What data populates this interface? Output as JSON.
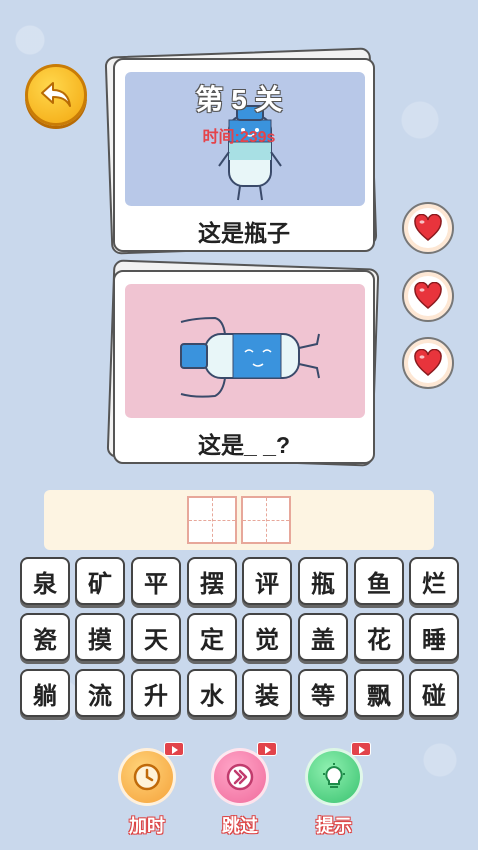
{
  "level": {
    "title": "第 5 关",
    "timer": "时间:239s"
  },
  "cards": [
    {
      "caption": "这是瓶子",
      "image": "bottle-standing"
    },
    {
      "caption": "这是_ _?",
      "image": "bottle-lying"
    }
  ],
  "lives": {
    "count": 3,
    "icon": "heart-icon"
  },
  "answer": {
    "slots": [
      "",
      ""
    ]
  },
  "keyboard": {
    "rows": [
      [
        "泉",
        "矿",
        "平",
        "摆",
        "评",
        "瓶",
        "鱼",
        "烂"
      ],
      [
        "瓷",
        "摸",
        "天",
        "定",
        "觉",
        "盖",
        "花",
        "睡"
      ],
      [
        "躺",
        "流",
        "升",
        "水",
        "装",
        "等",
        "飘",
        "碰"
      ]
    ]
  },
  "tools": [
    {
      "label": "加时",
      "icon": "clock-icon",
      "color": "#f5a23a"
    },
    {
      "label": "跳过",
      "icon": "skip-icon",
      "color": "#f06b9c"
    },
    {
      "label": "提示",
      "icon": "lightbulb-icon",
      "color": "#38c26f"
    }
  ]
}
